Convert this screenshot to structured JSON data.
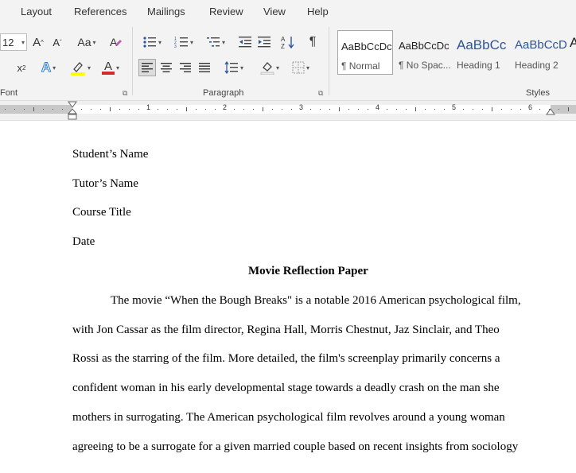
{
  "tabs": [
    "Layout",
    "References",
    "Mailings",
    "Review",
    "View",
    "Help"
  ],
  "font_group": {
    "size_value": "12",
    "grow_label": "A",
    "shrink_label": "A",
    "case_label": "Aa",
    "subscript_label": "x",
    "superscript_label": "x",
    "text_effects_label": "A",
    "font_color_label": "A",
    "label": "Font"
  },
  "paragraph_group": {
    "label": "Paragraph",
    "pilcrow": "¶"
  },
  "styles_group": {
    "label": "Styles",
    "items": [
      {
        "sample": "AaBbCcDc",
        "name": "¶ Normal"
      },
      {
        "sample": "AaBbCcDc",
        "name": "¶ No Spac..."
      },
      {
        "sample": "AaBbCc",
        "name": "Heading 1"
      },
      {
        "sample": "AaBbCcD",
        "name": "Heading 2"
      }
    ]
  },
  "ruler": {
    "numbers": [
      "1",
      "2",
      "3",
      "4",
      "5",
      "6"
    ]
  },
  "document": {
    "header_lines": [
      "Student’s Name",
      "Tutor’s Name",
      "Course Title",
      "Date"
    ],
    "title": "Movie Reflection Paper",
    "body_lines": [
      "The movie “When the Bough Breaks\" is a notable 2016 American psychological film,",
      "with Jon Cassar as the film director, Regina Hall, Morris Chestnut, Jaz Sinclair, and Theo",
      "Rossi as the starring of the film. More detailed, the film's screenplay primarily concerns a",
      "confident woman in his early developmental stage towards a deadly crash on the man she",
      "mothers in surrogating. The American psychological film revolves around a young woman",
      "agreeing to be a surrogate for a given married couple based on recent insights from sociology"
    ]
  },
  "colors": {
    "highlight": "#ffff00",
    "font_color": "#d42a2a",
    "text_effect": "#2b7cd3",
    "heading_blue": "#2f5496"
  }
}
